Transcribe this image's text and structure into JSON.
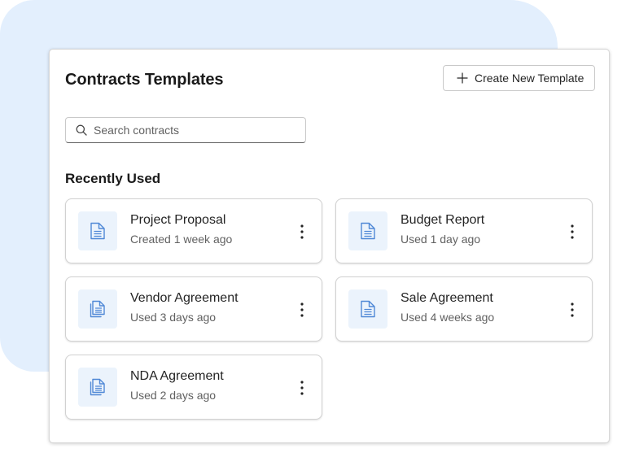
{
  "panel": {
    "title": "Contracts Templates",
    "create_button_label": "Create New Template"
  },
  "search": {
    "placeholder": "Search contracts",
    "value": ""
  },
  "recent": {
    "section_title": "Recently Used",
    "cards": [
      {
        "name": "Project Proposal",
        "meta": "Created 1 week ago",
        "icon": "document-icon"
      },
      {
        "name": "Budget Report",
        "meta": "Used 1 day ago",
        "icon": "document-icon"
      },
      {
        "name": "Vendor Agreement",
        "meta": "Used 3 days ago",
        "icon": "document-copy-icon"
      },
      {
        "name": "Sale Agreement",
        "meta": "Used 4 weeks ago",
        "icon": "document-icon"
      },
      {
        "name": "NDA Agreement",
        "meta": "Used 2 days ago",
        "icon": "document-copy-icon"
      }
    ]
  },
  "colors": {
    "accent": "#4f88d6",
    "icon_tile_bg": "#ebf3fc",
    "backdrop": "#e3effd",
    "more_icon": "#242424"
  }
}
